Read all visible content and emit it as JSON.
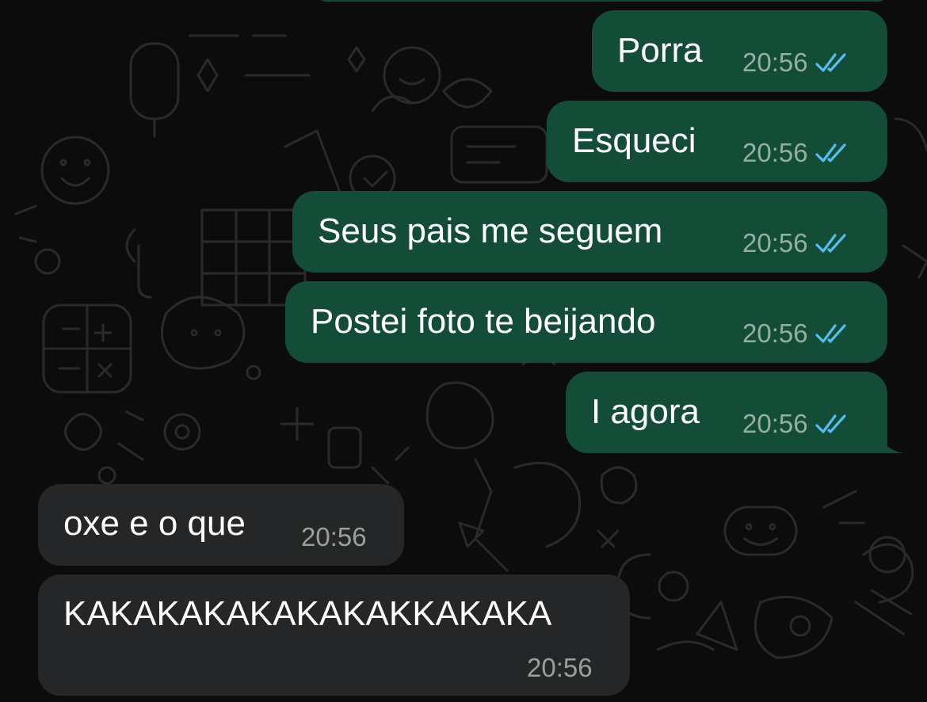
{
  "colors": {
    "background": "#0c0c0c",
    "outgoing_bubble": "#144d37",
    "incoming_bubble": "#242627",
    "read_ticks": "#53bdeb",
    "timestamp": "#9aa59f"
  },
  "messages": [
    {
      "direction": "outgoing",
      "text": "Porra",
      "time": "20:56",
      "status": "read",
      "status_icon": "double-check-icon"
    },
    {
      "direction": "outgoing",
      "text": "Esqueci",
      "time": "20:56",
      "status": "read",
      "status_icon": "double-check-icon"
    },
    {
      "direction": "outgoing",
      "text": "Seus pais me seguem",
      "time": "20:56",
      "status": "read",
      "status_icon": "double-check-icon"
    },
    {
      "direction": "outgoing",
      "text": "Postei foto te beijando",
      "time": "20:56",
      "status": "read",
      "status_icon": "double-check-icon"
    },
    {
      "direction": "outgoing",
      "text": "I agora",
      "time": "20:56",
      "status": "read",
      "status_icon": "double-check-icon"
    },
    {
      "direction": "incoming",
      "text": "oxe e o que",
      "time": "20:56"
    },
    {
      "direction": "incoming",
      "text": "KAKAKAKAKAKAKAKKAKAKA",
      "time": "20:56"
    }
  ]
}
